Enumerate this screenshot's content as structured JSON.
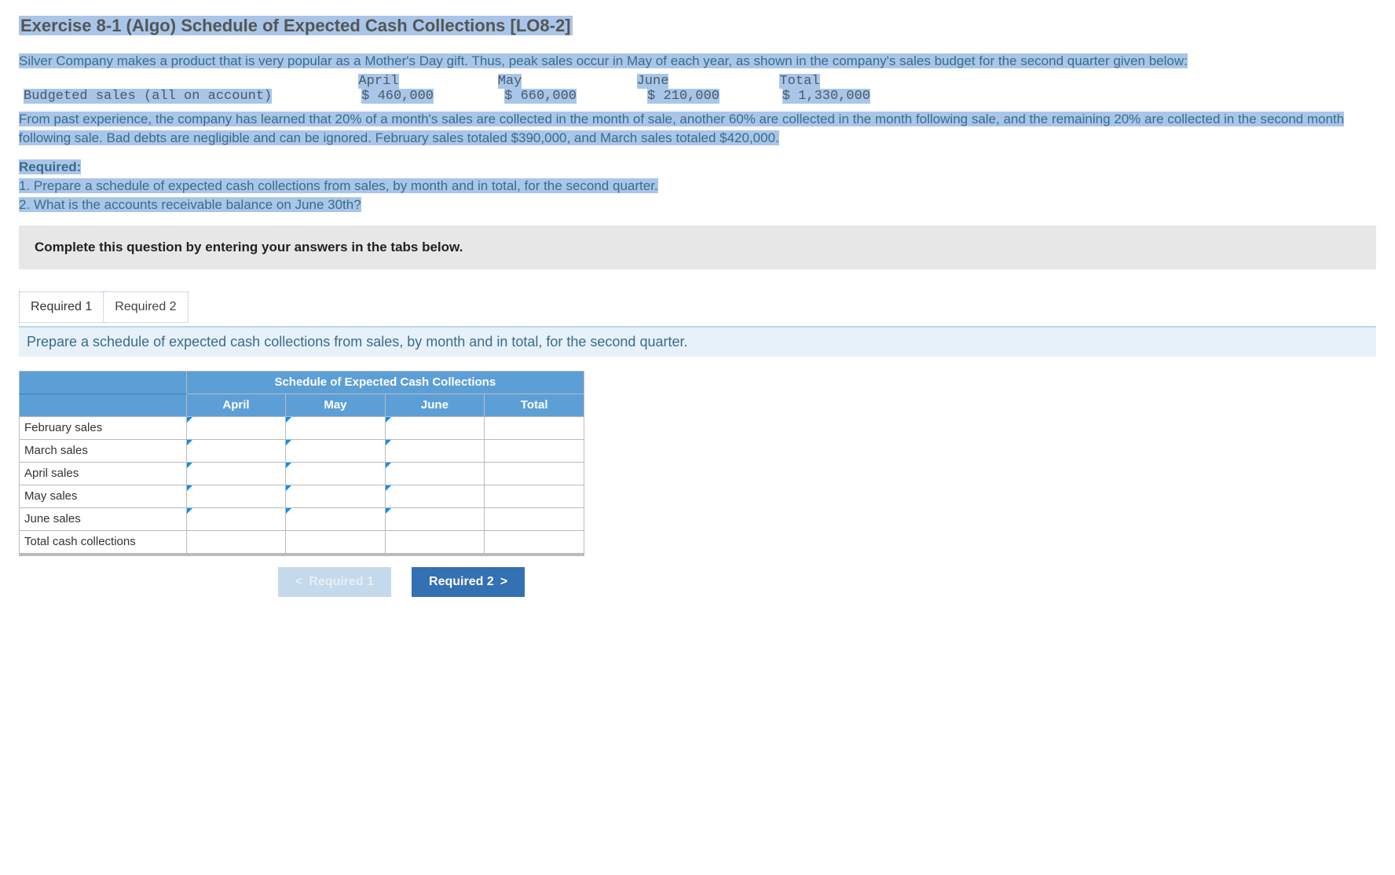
{
  "title": "Exercise 8-1 (Algo) Schedule of Expected Cash Collections [LO8-2]",
  "para1": "Silver Company makes a product that is very popular as a Mother's Day gift. Thus, peak sales occur in May of each year, as shown in the company's sales budget for the second quarter given below:",
  "budget": {
    "row_label": "Budgeted sales (all on account)",
    "columns": [
      "April",
      "May",
      "June",
      "Total"
    ],
    "values": [
      "$ 460,000",
      "$ 660,000",
      "$ 210,000",
      "$ 1,330,000"
    ]
  },
  "para2": "From past experience, the company has learned that 20% of a month's sales are collected in the month of sale, another 60% are collected in the month following sale, and the remaining 20% are collected in the second month following sale. Bad debts are negligible and can be ignored. February sales totaled $390,000, and March sales totaled $420,000.",
  "required_heading": "Required:",
  "required_1": "1. Prepare a schedule of expected cash collections from sales, by month and in total, for the second quarter.",
  "required_2": "2. What is the accounts receivable balance on June 30th?",
  "instruction_bar": "Complete this question by entering your answers in the tabs below.",
  "tabs": {
    "t1": "Required 1",
    "t2": "Required 2"
  },
  "sub_instruction": "Prepare a schedule of expected cash collections from sales, by month and in total, for the second quarter.",
  "schedule": {
    "title": "Schedule of Expected Cash Collections",
    "cols": [
      "April",
      "May",
      "June",
      "Total"
    ],
    "rows": [
      "February sales",
      "March sales",
      "April sales",
      "May sales",
      "June sales",
      "Total cash collections"
    ]
  },
  "nav": {
    "prev": "Required 1",
    "next": "Required 2"
  }
}
